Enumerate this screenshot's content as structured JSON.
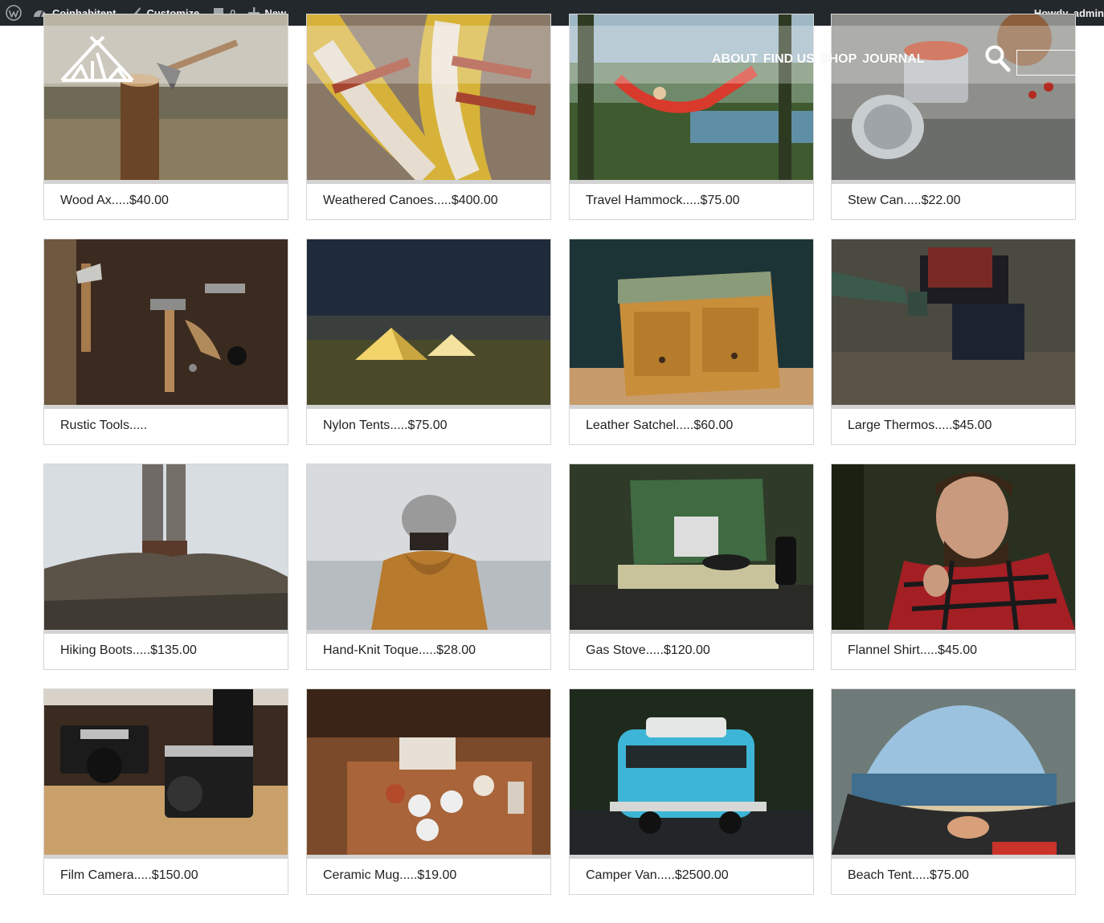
{
  "admin_bar": {
    "site_name": "Coinhabitent",
    "customize_label": "Customize",
    "comments_count": "0",
    "new_label": "New",
    "greeting": "Howdy, admin"
  },
  "header": {
    "nav": [
      {
        "label": "ABOUT"
      },
      {
        "label": "FIND US"
      },
      {
        "label": "SHOP"
      },
      {
        "label": "JOURNAL"
      }
    ],
    "search_placeholder": ""
  },
  "products": [
    {
      "name": "Wood Ax",
      "sep": ".....",
      "price": "$40.00",
      "icon": "wood-ax-photo"
    },
    {
      "name": "Weathered Canoes",
      "sep": ".....",
      "price": "$400.00",
      "icon": "canoes-photo"
    },
    {
      "name": "Travel Hammock",
      "sep": ".....",
      "price": "$75.00",
      "icon": "hammock-photo"
    },
    {
      "name": "Stew Can",
      "sep": ".....",
      "price": "$22.00",
      "icon": "stew-can-photo"
    },
    {
      "name": "Rustic Tools",
      "sep": ".....",
      "price": "",
      "icon": "tools-photo"
    },
    {
      "name": "Nylon Tents",
      "sep": ".....",
      "price": "$75.00",
      "icon": "tents-photo"
    },
    {
      "name": "Leather Satchel",
      "sep": ".....",
      "price": "$60.00",
      "icon": "satchel-photo"
    },
    {
      "name": "Large Thermos",
      "sep": ".....",
      "price": "$45.00",
      "icon": "thermos-photo"
    },
    {
      "name": "Hiking Boots",
      "sep": ".....",
      "price": "$135.00",
      "icon": "boots-photo"
    },
    {
      "name": "Hand-Knit Toque",
      "sep": ".....",
      "price": "$28.00",
      "icon": "toque-photo"
    },
    {
      "name": "Gas Stove",
      "sep": ".....",
      "price": "$120.00",
      "icon": "stove-photo"
    },
    {
      "name": "Flannel Shirt",
      "sep": ".....",
      "price": "$45.00",
      "icon": "flannel-photo"
    },
    {
      "name": "Film Camera",
      "sep": ".....",
      "price": "$150.00",
      "icon": "camera-photo"
    },
    {
      "name": "Ceramic Mug",
      "sep": ".....",
      "price": "$19.00",
      "icon": "mugs-photo"
    },
    {
      "name": "Camper Van",
      "sep": ".....",
      "price": "$2500.00",
      "icon": "van-photo"
    },
    {
      "name": "Beach Tent",
      "sep": ".....",
      "price": "$75.00",
      "icon": "beach-tent-photo"
    }
  ],
  "colors": {
    "admin_bar_bg": "#23282d",
    "card_border": "#d6d6d6",
    "card_bar": "#d3d3d3"
  }
}
